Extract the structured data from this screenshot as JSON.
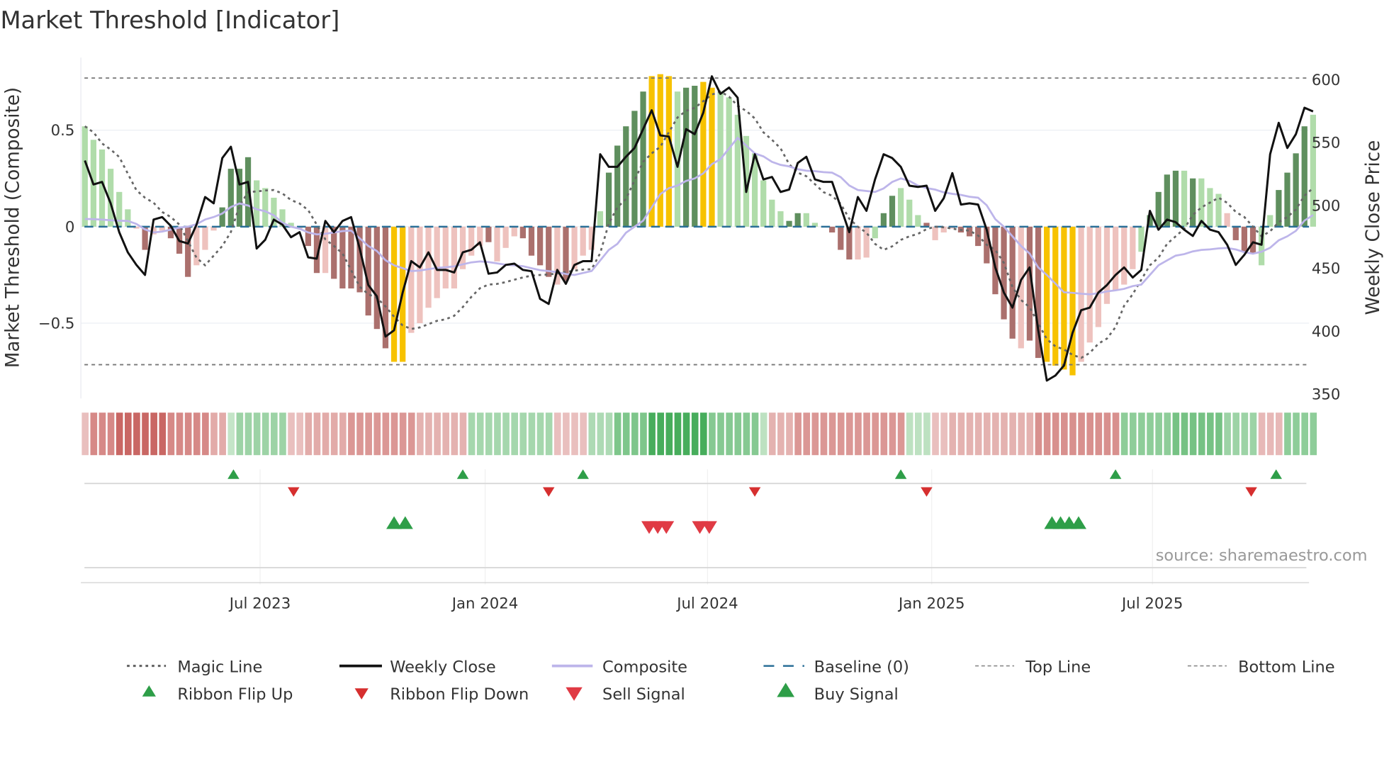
{
  "chart_data": {
    "type": "bar",
    "title": "Market Threshold [Indicator]",
    "ylabel": "Market Threshold (Composite)",
    "y2label": "Weekly Close Price",
    "source": "source: sharemaestro.com",
    "x_unit": "week index (weekly bars, ~Feb 2023 to Nov 2025)",
    "ylim": [
      -0.89,
      0.88
    ],
    "y2lim": [
      346,
      617
    ],
    "yticks": [
      {
        "v": 0.5,
        "label": "0.5"
      },
      {
        "v": 0,
        "label": "0"
      },
      {
        "v": -0.5,
        "label": "−0.5"
      }
    ],
    "y2ticks": [
      {
        "v": 600,
        "label": "600"
      },
      {
        "v": 550,
        "label": "550"
      },
      {
        "v": 500,
        "label": "500"
      },
      {
        "v": 450,
        "label": "450"
      },
      {
        "v": 400,
        "label": "400"
      },
      {
        "v": 350,
        "label": "350"
      }
    ],
    "xticks": [
      {
        "i": 20.4,
        "label": "Jul 2023"
      },
      {
        "i": 46.6,
        "label": "Jan 2024"
      },
      {
        "i": 72.5,
        "label": "Jul 2024"
      },
      {
        "i": 98.6,
        "label": "Jan 2025"
      },
      {
        "i": 124.3,
        "label": "Jul 2025"
      }
    ],
    "top_line": 0.77,
    "bottom_line": -0.715,
    "colors": {
      "g": "#b0dcaa",
      "G": "#5f8f5e",
      "r": "#eec2be",
      "R": "#ab706d",
      "y": "#f7c200",
      "close": "#111111",
      "composite": "#bdb5ea",
      "magic": "#666666",
      "baseline": "#2a6f97",
      "buy": "#2e9e48",
      "sell": "#e03a44",
      "flip_up": "#2e9e48",
      "flip_down": "#d62f2f"
    },
    "bars": [
      0.52,
      0.45,
      0.4,
      0.3,
      0.18,
      0.09,
      -0.01,
      -0.12,
      -0.04,
      -0.02,
      -0.06,
      -0.14,
      -0.26,
      -0.2,
      -0.12,
      -0.02,
      0.1,
      0.3,
      0.3,
      0.36,
      0.24,
      0.2,
      0.15,
      0.09,
      0.02,
      -0.01,
      -0.1,
      -0.24,
      -0.24,
      -0.27,
      -0.32,
      -0.32,
      -0.34,
      -0.46,
      -0.53,
      -0.63,
      -0.7,
      -0.7,
      -0.55,
      -0.5,
      -0.42,
      -0.37,
      -0.32,
      -0.32,
      -0.22,
      -0.15,
      -0.1,
      -0.08,
      -0.18,
      -0.11,
      -0.05,
      -0.06,
      -0.15,
      -0.2,
      -0.26,
      -0.3,
      -0.28,
      -0.22,
      -0.15,
      -0.12,
      0.08,
      0.28,
      0.42,
      0.52,
      0.6,
      0.7,
      0.78,
      0.79,
      0.78,
      0.7,
      0.72,
      0.73,
      0.75,
      0.72,
      0.7,
      0.67,
      0.58,
      0.47,
      0.38,
      0.24,
      0.14,
      0.08,
      0.03,
      0.07,
      0.07,
      0.02,
      0.0,
      -0.03,
      -0.12,
      -0.17,
      -0.17,
      -0.16,
      -0.06,
      0.07,
      0.16,
      0.2,
      0.14,
      0.06,
      0.02,
      -0.07,
      -0.03,
      -0.01,
      -0.03,
      -0.05,
      -0.1,
      -0.19,
      -0.35,
      -0.48,
      -0.58,
      -0.63,
      -0.59,
      -0.68,
      -0.7,
      -0.72,
      -0.74,
      -0.77,
      -0.7,
      -0.6,
      -0.52,
      -0.4,
      -0.33,
      -0.3,
      -0.22,
      -0.13,
      0.06,
      0.18,
      0.27,
      0.29,
      0.29,
      0.25,
      0.25,
      0.2,
      0.17,
      0.07,
      -0.07,
      -0.13,
      -0.14,
      -0.2,
      0.06,
      0.19,
      0.28,
      0.38,
      0.52,
      0.58
    ],
    "bar_class": "ggggggrRrrRRRrrrGGGGgggggrRRrRRRRRRRyyrrrrrrrrrRrrrRRRRrRrrrgGGGGGyyygGGyyggggggggGGggrRRRrrgGGgggRrrrRRRRRRRrRRyyyyrrrrrrrgGGGGgGgggrRRRggGGGG",
    "weekly_close": [
      535,
      516,
      518,
      501,
      478,
      462,
      452,
      444,
      488,
      490,
      483,
      471,
      469,
      484,
      506,
      501,
      537,
      546,
      516,
      518,
      465,
      472,
      488,
      484,
      474,
      478,
      458,
      457,
      487,
      478,
      487,
      490,
      465,
      436,
      427,
      395,
      400,
      430,
      455,
      450,
      462,
      448,
      448,
      446,
      462,
      464,
      470,
      445,
      446,
      452,
      453,
      448,
      447,
      425,
      421,
      448,
      437,
      452,
      455,
      455,
      540,
      530,
      530,
      538,
      545,
      560,
      575,
      555,
      554,
      530,
      560,
      556,
      573,
      602,
      588,
      593,
      585,
      510,
      540,
      520,
      522,
      510,
      512,
      533,
      538,
      520,
      518,
      518,
      498,
      478,
      506,
      495,
      520,
      540,
      537,
      530,
      515,
      514,
      515,
      495,
      505,
      525,
      500,
      501,
      500,
      480,
      450,
      430,
      418,
      440,
      450,
      400,
      360,
      364,
      372,
      398,
      416,
      418,
      430,
      436,
      444,
      450,
      442,
      448,
      495,
      480,
      488,
      486,
      480,
      475,
      487,
      480,
      478,
      468,
      452,
      460,
      470,
      468,
      540,
      565,
      545,
      556,
      577,
      574
    ],
    "composite_knots": [
      [
        0,
        0.04
      ],
      [
        5,
        0.03
      ],
      [
        8,
        -0.03
      ],
      [
        12,
        0.0
      ],
      [
        15,
        0.05
      ],
      [
        18,
        0.12
      ],
      [
        21,
        0.08
      ],
      [
        24,
        0.0
      ],
      [
        27,
        -0.04
      ],
      [
        31,
        -0.02
      ],
      [
        33,
        -0.1
      ],
      [
        36,
        -0.2
      ],
      [
        38,
        -0.23
      ],
      [
        42,
        -0.21
      ],
      [
        46,
        -0.18
      ],
      [
        50,
        -0.2
      ],
      [
        54,
        -0.23
      ],
      [
        57,
        -0.25
      ],
      [
        59,
        -0.23
      ],
      [
        61,
        -0.12
      ],
      [
        64,
        0.0
      ],
      [
        68,
        0.2
      ],
      [
        71,
        0.25
      ],
      [
        74,
        0.35
      ],
      [
        76,
        0.46
      ],
      [
        78,
        0.38
      ],
      [
        81,
        0.32
      ],
      [
        84,
        0.29
      ],
      [
        87,
        0.28
      ],
      [
        90,
        0.19
      ],
      [
        92,
        0.18
      ],
      [
        95,
        0.25
      ],
      [
        98,
        0.2
      ],
      [
        101,
        0.17
      ],
      [
        104,
        0.15
      ],
      [
        107,
        0.0
      ],
      [
        109,
        -0.1
      ],
      [
        112,
        -0.25
      ],
      [
        114,
        -0.34
      ],
      [
        117,
        -0.35
      ],
      [
        120,
        -0.33
      ],
      [
        123,
        -0.3
      ],
      [
        125,
        -0.2
      ],
      [
        127,
        -0.15
      ],
      [
        130,
        -0.12
      ],
      [
        133,
        -0.11
      ],
      [
        136,
        -0.14
      ],
      [
        137,
        -0.13
      ],
      [
        140,
        -0.05
      ],
      [
        143,
        0.06
      ]
    ],
    "magic_knots": [
      [
        0,
        0.52
      ],
      [
        3,
        0.4
      ],
      [
        7,
        0.15
      ],
      [
        10,
        0.05
      ],
      [
        14,
        -0.2
      ],
      [
        16,
        -0.1
      ],
      [
        19,
        0.18
      ],
      [
        22,
        0.19
      ],
      [
        25,
        0.12
      ],
      [
        29,
        -0.1
      ],
      [
        33,
        -0.35
      ],
      [
        38,
        -0.53
      ],
      [
        42,
        -0.48
      ],
      [
        47,
        -0.3
      ],
      [
        53,
        -0.25
      ],
      [
        59,
        -0.22
      ],
      [
        62,
        0.1
      ],
      [
        66,
        0.38
      ],
      [
        70,
        0.6
      ],
      [
        74,
        0.7
      ],
      [
        77,
        0.6
      ],
      [
        80,
        0.45
      ],
      [
        83,
        0.28
      ],
      [
        87,
        0.16
      ],
      [
        90,
        0.0
      ],
      [
        93,
        -0.12
      ],
      [
        96,
        -0.05
      ],
      [
        99,
        0.0
      ],
      [
        103,
        -0.02
      ],
      [
        106,
        -0.12
      ],
      [
        109,
        -0.38
      ],
      [
        113,
        -0.62
      ],
      [
        116,
        -0.68
      ],
      [
        119,
        -0.58
      ],
      [
        122,
        -0.35
      ],
      [
        124,
        -0.2
      ],
      [
        127,
        -0.05
      ],
      [
        130,
        0.1
      ],
      [
        132,
        0.15
      ],
      [
        135,
        0.05
      ],
      [
        137,
        -0.05
      ],
      [
        140,
        0.05
      ],
      [
        143,
        0.2
      ]
    ],
    "ribbon_segments": [
      [
        0,
        0,
        -0.2
      ],
      [
        1,
        3,
        -0.6
      ],
      [
        4,
        9,
        -0.85
      ],
      [
        10,
        14,
        -0.6
      ],
      [
        15,
        16,
        -0.35
      ],
      [
        17,
        17,
        0.15
      ],
      [
        18,
        23,
        0.4
      ],
      [
        24,
        25,
        -0.2
      ],
      [
        26,
        30,
        -0.35
      ],
      [
        31,
        38,
        -0.5
      ],
      [
        39,
        44,
        -0.3
      ],
      [
        45,
        54,
        0.35
      ],
      [
        55,
        58,
        -0.2
      ],
      [
        59,
        61,
        0.3
      ],
      [
        62,
        65,
        0.6
      ],
      [
        66,
        72,
        0.95
      ],
      [
        73,
        78,
        0.55
      ],
      [
        79,
        79,
        0.2
      ],
      [
        80,
        82,
        -0.3
      ],
      [
        83,
        95,
        -0.5
      ],
      [
        96,
        98,
        0.2
      ],
      [
        99,
        100,
        -0.2
      ],
      [
        101,
        110,
        -0.3
      ],
      [
        111,
        120,
        -0.55
      ],
      [
        121,
        126,
        0.5
      ],
      [
        127,
        132,
        0.65
      ],
      [
        133,
        136,
        0.4
      ],
      [
        137,
        139,
        -0.25
      ],
      [
        140,
        143,
        0.5
      ]
    ],
    "ribbon_flip_up": [
      17.3,
      44,
      58,
      95,
      120,
      138.7
    ],
    "ribbon_flip_down": [
      24.3,
      54,
      78,
      98,
      135.8
    ],
    "buy_signals": [
      36,
      37.3,
      112.6,
      113.6,
      114.6,
      115.7
    ],
    "sell_signals": [
      65.7,
      66.7,
      67.7,
      71.6,
      72.7
    ],
    "legend": [
      {
        "key": "magic",
        "label": "Magic Line"
      },
      {
        "key": "close",
        "label": "Weekly Close"
      },
      {
        "key": "composite",
        "label": "Composite"
      },
      {
        "key": "baseline",
        "label": "Baseline (0)"
      },
      {
        "key": "top",
        "label": "Top Line"
      },
      {
        "key": "bottom",
        "label": "Bottom Line"
      },
      {
        "key": "flip_up",
        "label": "Ribbon Flip Up"
      },
      {
        "key": "flip_down",
        "label": "Ribbon Flip Down"
      },
      {
        "key": "sell",
        "label": "Sell Signal"
      },
      {
        "key": "buy",
        "label": "Buy Signal"
      }
    ]
  }
}
